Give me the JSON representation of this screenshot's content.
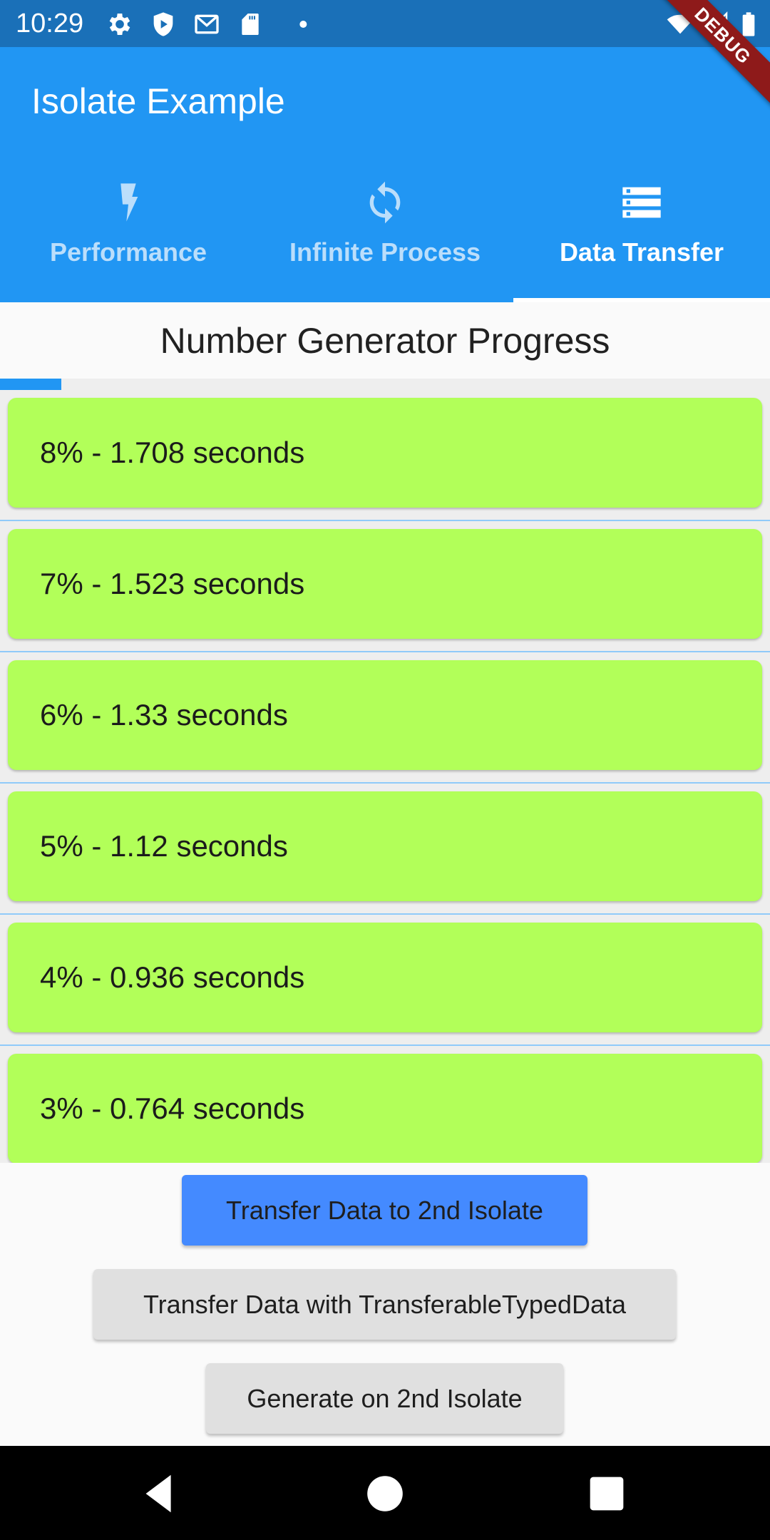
{
  "status_bar": {
    "time": "10:29",
    "icons": [
      "settings-icon",
      "shield-play-icon",
      "gmail-icon",
      "sd-card-icon",
      "notification-dot-icon",
      "wifi-icon",
      "cell-signal-icon",
      "battery-icon"
    ]
  },
  "app_bar": {
    "title": "Isolate Example"
  },
  "tabs": [
    {
      "label": "Performance",
      "icon": "flash-icon",
      "active": false
    },
    {
      "label": "Infinite Process",
      "icon": "sync-icon",
      "active": false
    },
    {
      "label": "Data Transfer",
      "icon": "storage-icon",
      "active": true
    }
  ],
  "page": {
    "header": "Number Generator Progress",
    "progress_percent": 8
  },
  "list": {
    "items": [
      {
        "text": "8% - 1.708 seconds"
      },
      {
        "text": "7% - 1.523 seconds"
      },
      {
        "text": "6% - 1.33 seconds"
      },
      {
        "text": "5% - 1.12 seconds"
      },
      {
        "text": "4% - 0.936 seconds"
      },
      {
        "text": "3% - 0.764 seconds"
      }
    ]
  },
  "buttons": {
    "transfer": "Transfer Data to 2nd Isolate",
    "transferable": "Transfer Data with TransferableTypedData",
    "generate": "Generate on 2nd Isolate"
  },
  "debug_banner": "DEBUG",
  "colors": {
    "primary": "#2196f3",
    "status_bar": "#1a70b8",
    "card": "#b2ff59",
    "active_button": "#448aff",
    "inactive_button": "#e0e0e0"
  }
}
